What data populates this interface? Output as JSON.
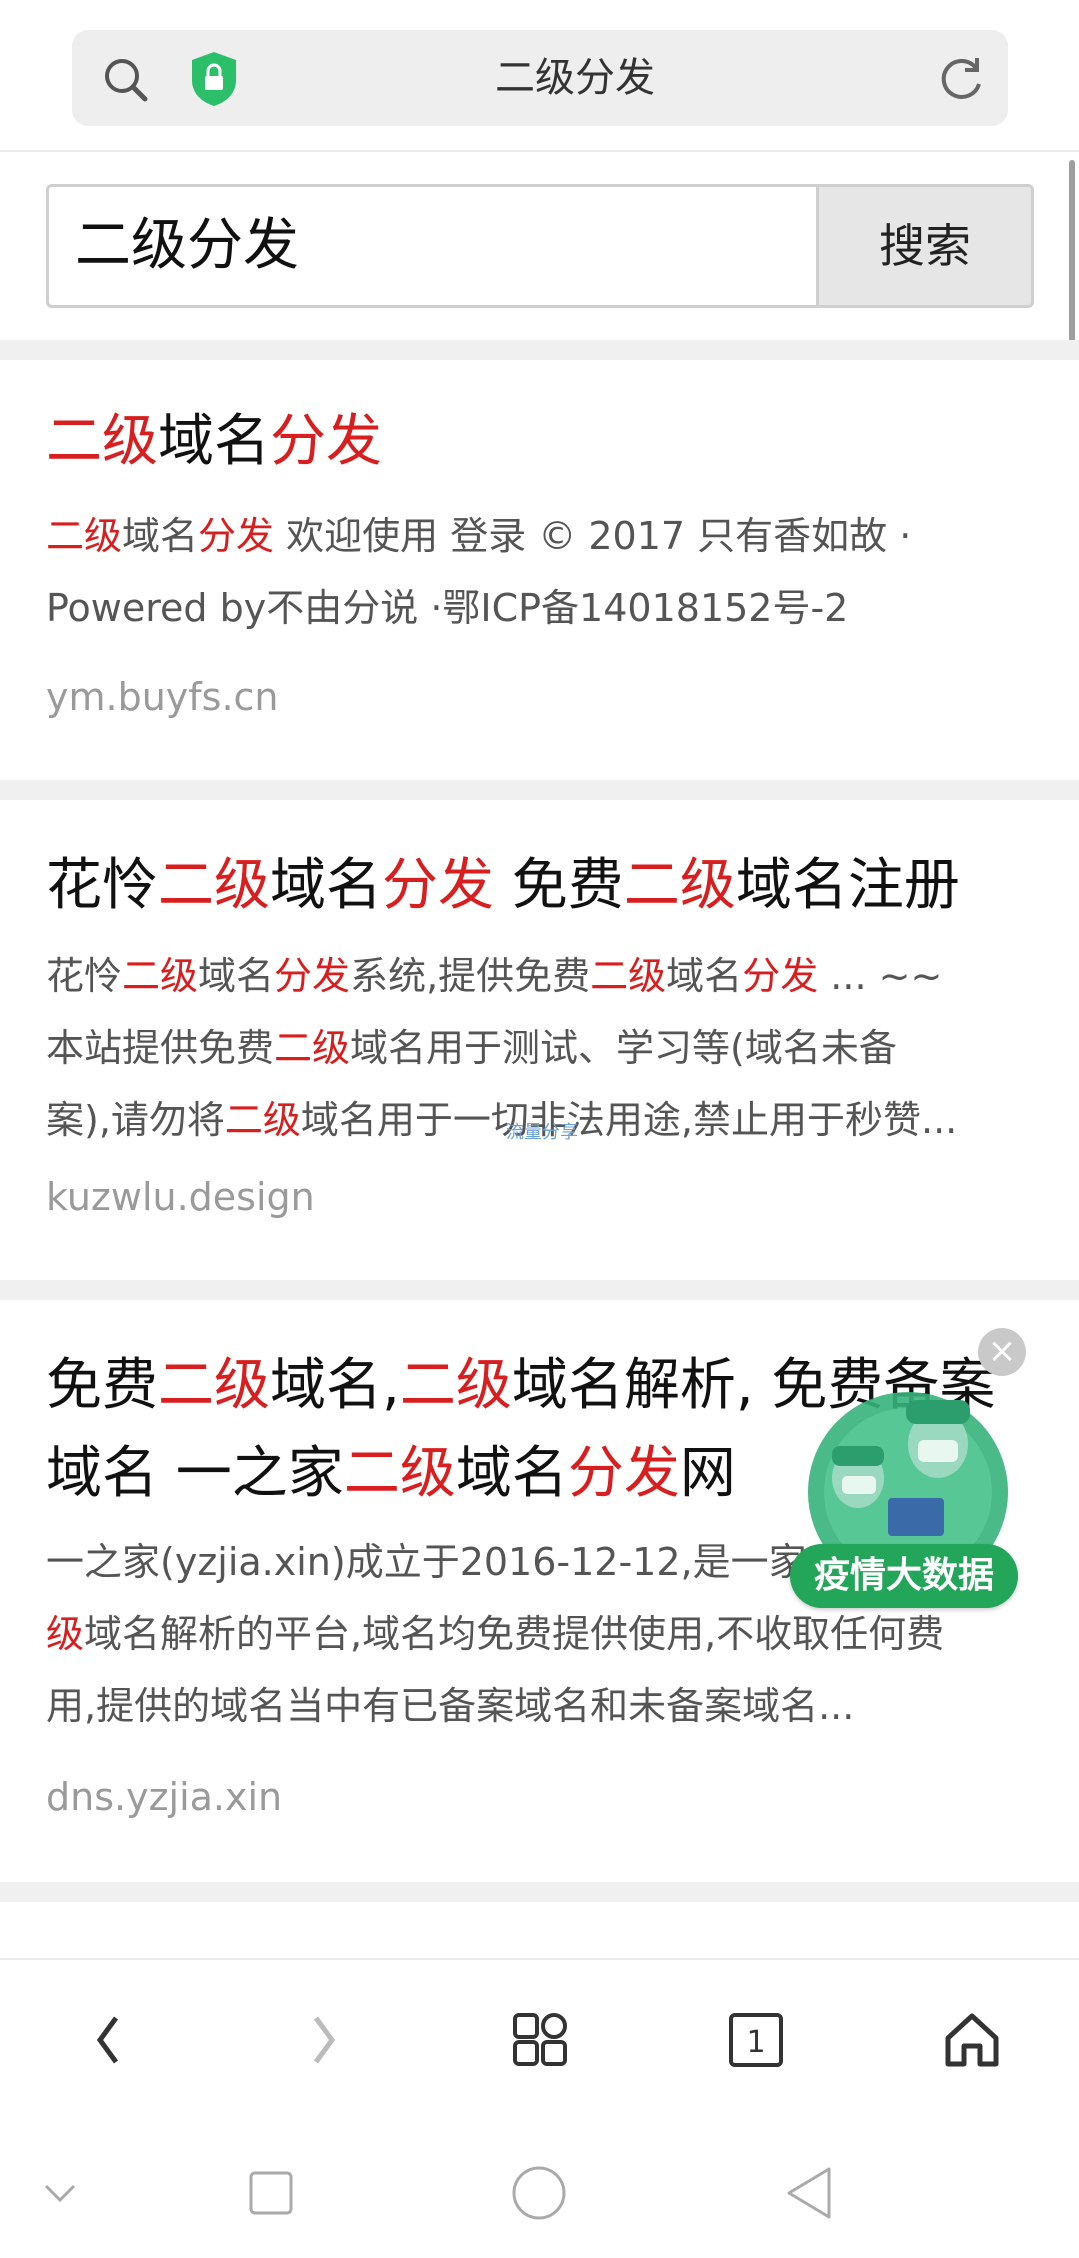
{
  "browser": {
    "url_title": "二级分发",
    "search_icon": "search-icon",
    "lock_icon": "lock-shield-icon",
    "refresh_icon": "refresh-icon"
  },
  "search": {
    "query": "二级分发",
    "button_label": "搜索"
  },
  "results": [
    {
      "title": [
        [
          "二级",
          true
        ],
        [
          "域名",
          false
        ],
        [
          "分发",
          true
        ]
      ],
      "desc_lines": [
        [
          [
            "二级",
            true
          ],
          [
            "域名",
            false
          ],
          [
            "分发",
            true
          ],
          [
            " 欢迎使用 登录 © 2017 只有香如故 ·",
            false
          ]
        ],
        [
          [
            "Powered by不由分说 ·鄂ICP备14018152号-2",
            false
          ]
        ]
      ],
      "host": "ym.buyfs.cn"
    },
    {
      "title": [
        [
          "花怜",
          false
        ],
        [
          "二级",
          true
        ],
        [
          "域名",
          false
        ],
        [
          "分发",
          true
        ],
        [
          " 免费",
          false
        ],
        [
          "二级",
          true
        ],
        [
          "域名注册",
          false
        ]
      ],
      "desc_lines": [
        [
          [
            "花怜",
            false
          ],
          [
            "二级",
            true
          ],
          [
            "域名",
            false
          ],
          [
            "分发",
            true
          ],
          [
            "系统,提供免费",
            false
          ],
          [
            "二级",
            true
          ],
          [
            "域名",
            false
          ],
          [
            "分发",
            true
          ],
          [
            " ... ~~",
            false
          ]
        ],
        [
          [
            "本站提供免费",
            false
          ],
          [
            "二级",
            true
          ],
          [
            "域名用于测试、学习等(域名未备",
            false
          ]
        ],
        [
          [
            "案),请勿将",
            false
          ],
          [
            "二级",
            true
          ],
          [
            "域名用于一切非法用途,禁止用于秒赞...",
            false
          ]
        ]
      ],
      "host": "kuzwlu.design"
    },
    {
      "title_lines": [
        [
          [
            "免费",
            false
          ],
          [
            "二级",
            true
          ],
          [
            "域名,",
            false
          ],
          [
            "二级",
            true
          ],
          [
            "域名解析, 免费备案",
            false
          ]
        ],
        [
          [
            "域名 一之家",
            false
          ],
          [
            "二级",
            true
          ],
          [
            "域名",
            false
          ],
          [
            "分发",
            true
          ],
          [
            "网",
            false
          ]
        ]
      ],
      "desc_lines": [
        [
          [
            "一之家(yzjia.xin)成立于2016-12-12,是一家",
            false
          ],
          [
            "二",
            true
          ]
        ],
        [
          [
            "级",
            true
          ],
          [
            "域名解析的平台,域名均免费提供使用,不收取任何费",
            false
          ]
        ],
        [
          [
            "用,提供的域名当中有已备案域名和未备案域名...",
            false
          ]
        ]
      ],
      "host": "dns.yzjia.xin"
    }
  ],
  "watermark": "流量分享",
  "float_ad": {
    "label": "疫情大数据",
    "close": "×"
  },
  "nav": {
    "tab_count": "1",
    "icons": [
      "back-icon",
      "forward-icon",
      "apps-icon",
      "tabs-icon",
      "home-icon"
    ]
  },
  "system_nav": {
    "icons": [
      "collapse-icon",
      "recents-icon",
      "home-circle-icon",
      "back-triangle-icon"
    ]
  },
  "colors": {
    "highlight": "#d81e1e",
    "host": "#9a9a9a",
    "ad_green": "#23a55a",
    "lock_green": "#2bbf6a"
  }
}
